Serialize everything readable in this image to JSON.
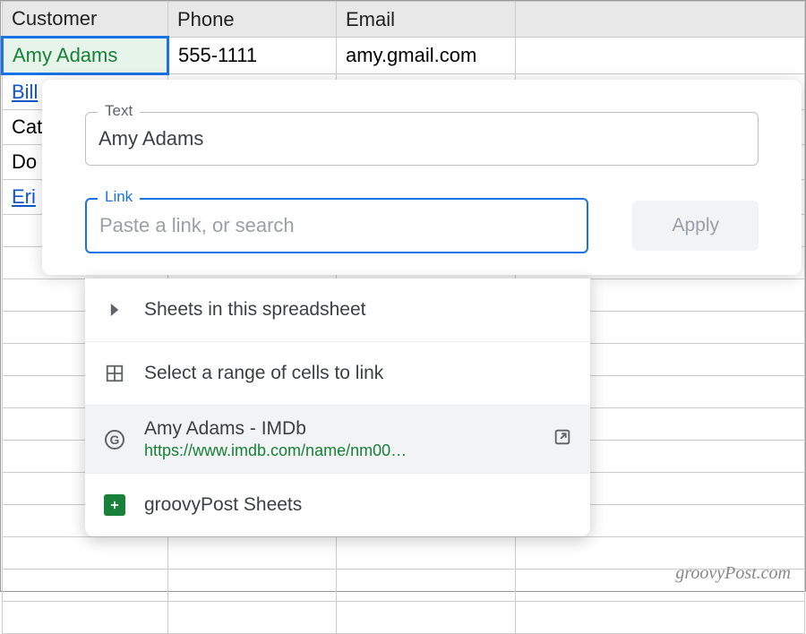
{
  "columns": {
    "customer": "Customer",
    "phone": "Phone",
    "email": "Email"
  },
  "rows": [
    {
      "customer": "Amy Adams",
      "phone": "555-1111",
      "email": "amy.gmail.com",
      "selected": true
    },
    {
      "customer": "Bill",
      "link": true
    },
    {
      "customer": "Cat"
    },
    {
      "customer": "Do"
    },
    {
      "customer": "Eri",
      "link": true
    }
  ],
  "linkEditor": {
    "textLabel": "Text",
    "textValue": "Amy Adams",
    "linkLabel": "Link",
    "linkPlaceholder": "Paste a link, or search",
    "applyLabel": "Apply"
  },
  "dropdown": {
    "sheetsInSpreadsheet": "Sheets in this spreadsheet",
    "selectRange": "Select a range of cells to link",
    "searchResult": {
      "title": "Amy Adams - IMDb",
      "url": "https://www.imdb.com/name/nm00…"
    },
    "existingSheet": "groovyPost Sheets"
  },
  "watermark": "groovyPost.com"
}
